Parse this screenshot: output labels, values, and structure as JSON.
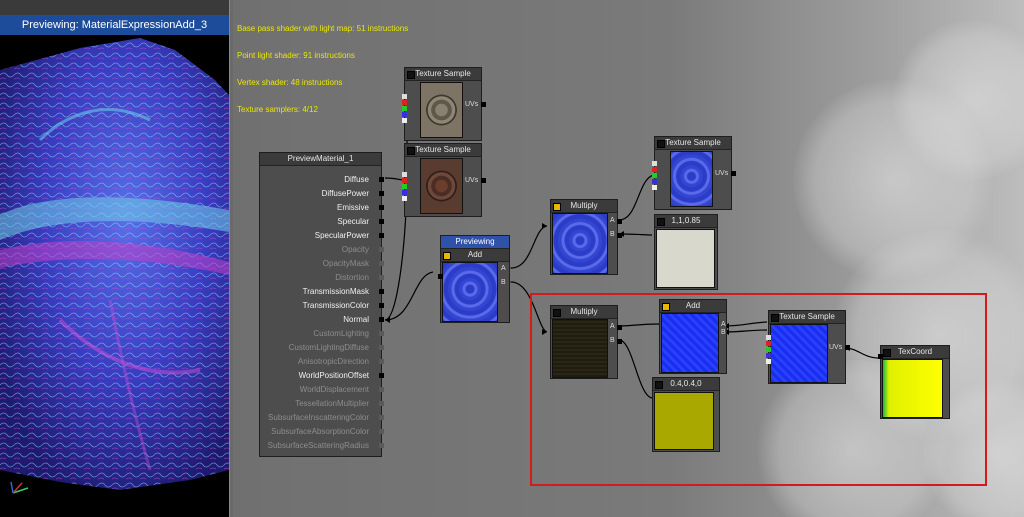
{
  "preview": {
    "title": "Previewing: MaterialExpressionAdd_3"
  },
  "stats": [
    "Base pass shader with light map: 51 instructions",
    "Point light shader: 91 instructions",
    "Vertex shader: 48 instructions",
    "Texture samplers: 4/12"
  ],
  "material_node": {
    "title": "PreviewMaterial_1",
    "inputs": [
      {
        "label": "Diffuse",
        "active": true
      },
      {
        "label": "DiffusePower",
        "active": true
      },
      {
        "label": "Emissive",
        "active": true
      },
      {
        "label": "Specular",
        "active": true
      },
      {
        "label": "SpecularPower",
        "active": true
      },
      {
        "label": "Opacity",
        "active": false
      },
      {
        "label": "OpacityMask",
        "active": false
      },
      {
        "label": "Distortion",
        "active": false
      },
      {
        "label": "TransmissionMask",
        "active": true
      },
      {
        "label": "TransmissionColor",
        "active": true
      },
      {
        "label": "Normal",
        "active": true
      },
      {
        "label": "CustomLighting",
        "active": false
      },
      {
        "label": "CustomLightingDiffuse",
        "active": false
      },
      {
        "label": "AnisotropicDirection",
        "active": false
      },
      {
        "label": "WorldPositionOffset",
        "active": true
      },
      {
        "label": "WorldDisplacement",
        "active": false
      },
      {
        "label": "TessellationMultiplier",
        "active": false
      },
      {
        "label": "SubsurfaceInscatteringColor",
        "active": false
      },
      {
        "label": "SubsurfaceAbsorptionColor",
        "active": false
      },
      {
        "label": "SubsurfaceScatteringRadius",
        "active": false
      }
    ]
  },
  "nodes": {
    "texture_sample_1": {
      "title": "Texture Sample",
      "uv": "UVs"
    },
    "texture_sample_2": {
      "title": "Texture Sample",
      "uv": "UVs"
    },
    "texture_sample_3": {
      "title": "Texture Sample",
      "uv": "UVs"
    },
    "texture_sample_4": {
      "title": "Texture Sample",
      "uv": "UVs"
    },
    "multiply_1": {
      "title": "Multiply",
      "a": "A",
      "b": "B"
    },
    "multiply_2": {
      "title": "Multiply",
      "a": "A",
      "b": "B"
    },
    "add_main": {
      "preview_label": "Previewing",
      "title": "Add",
      "a": "A",
      "b": "B"
    },
    "add_2": {
      "title": "Add",
      "a": "A",
      "b": "B"
    },
    "constant_1": {
      "title": "1,1,0.85",
      "color": "#d8d8cc"
    },
    "constant_2": {
      "title": "0.4,0.4,0",
      "color": "#a8a800"
    },
    "texcoord": {
      "title": "TexCoord"
    }
  },
  "colors": {
    "selection": "#d21c1c",
    "preview_header": "#2f52a8",
    "stats_text": "#e8e800"
  },
  "icons": {
    "axis": "axis-gizmo-icon"
  }
}
